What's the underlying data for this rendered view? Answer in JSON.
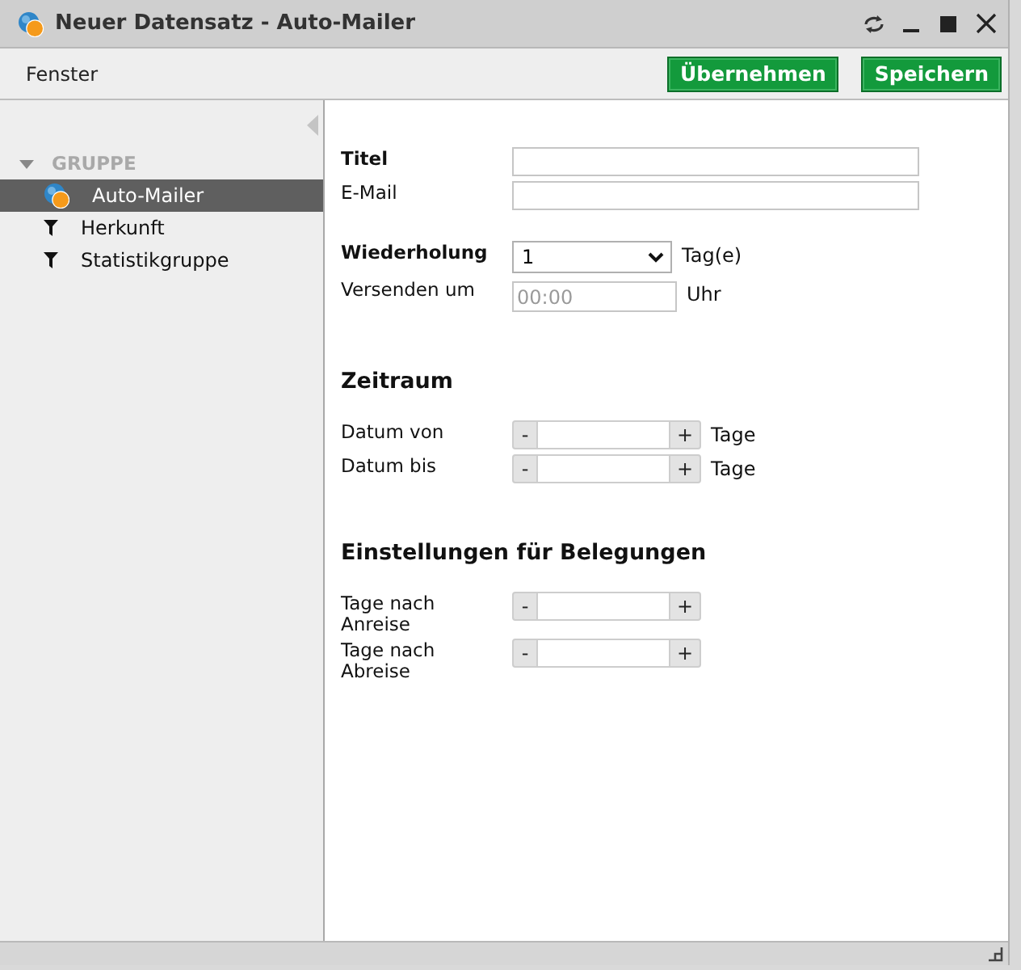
{
  "window": {
    "title": "Neuer Datensatz - Auto-Mailer"
  },
  "toolbar": {
    "menu": "Fenster",
    "buttons": [
      "Übernehmen",
      "Speichern"
    ]
  },
  "sidebar": {
    "group": {
      "label": "GRUPPE",
      "expanded": true
    },
    "items": [
      {
        "label": "Auto-Mailer",
        "kind": "mailer",
        "selected": true
      },
      {
        "label": "Herkunft",
        "kind": "filter",
        "selected": false
      },
      {
        "label": "Statistikgruppe",
        "kind": "filter",
        "selected": false
      }
    ]
  },
  "form": {
    "sections": [
      {
        "rows": [
          {
            "kind": "text",
            "label": "Titel",
            "bold": true
          },
          {
            "kind": "text",
            "label": "E-Mail",
            "bold": false
          }
        ]
      },
      {
        "rows": [
          {
            "kind": "select",
            "label": "Wiederholung",
            "bold": true,
            "value": "1",
            "unit": "Tag(e)"
          },
          {
            "kind": "time",
            "label": "Versenden um",
            "bold": false,
            "placeholder": "00:00",
            "unit": "Uhr"
          }
        ]
      },
      {
        "heading": "Zeitraum",
        "rows": [
          {
            "kind": "spinner",
            "label": "Datum von",
            "bold": false,
            "decrement": "-",
            "increment": "+",
            "unit": "Tage"
          },
          {
            "kind": "spinner",
            "label": "Datum bis",
            "bold": false,
            "decrement": "-",
            "increment": "+",
            "unit": "Tage"
          }
        ]
      },
      {
        "heading": "Einstellungen für Belegungen",
        "rows": [
          {
            "kind": "spinner",
            "label": "Tage nach Anreise",
            "bold": false,
            "decrement": "-",
            "increment": "+"
          },
          {
            "kind": "spinner",
            "label": "Tage nach Abreise",
            "bold": false,
            "decrement": "-",
            "increment": "+"
          }
        ]
      }
    ]
  }
}
